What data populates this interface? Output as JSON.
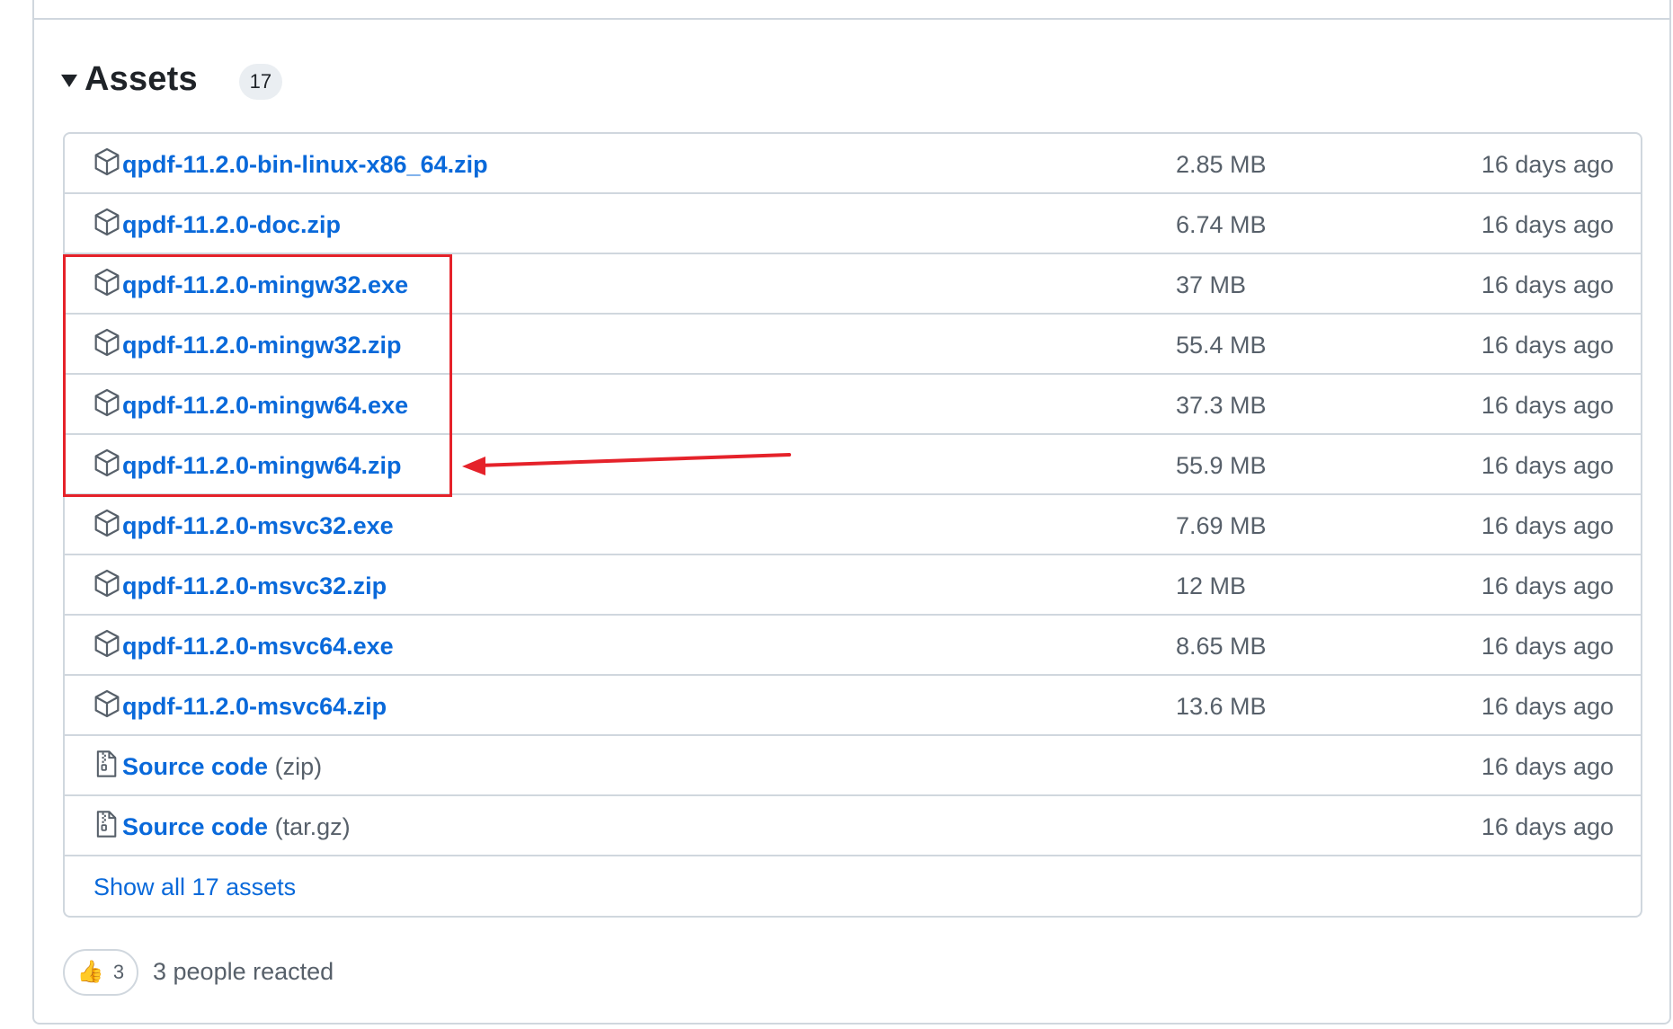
{
  "assets": {
    "title": "Assets",
    "count": "17",
    "rows": [
      {
        "name": "qpdf-11.2.0-bin-linux-x86_64.zip",
        "suffix": "",
        "size": "2.85 MB",
        "date": "16 days ago",
        "icon": "package-icon"
      },
      {
        "name": "qpdf-11.2.0-doc.zip",
        "suffix": "",
        "size": "6.74 MB",
        "date": "16 days ago",
        "icon": "package-icon"
      },
      {
        "name": "qpdf-11.2.0-mingw32.exe",
        "suffix": "",
        "size": "37 MB",
        "date": "16 days ago",
        "icon": "package-icon"
      },
      {
        "name": "qpdf-11.2.0-mingw32.zip",
        "suffix": "",
        "size": "55.4 MB",
        "date": "16 days ago",
        "icon": "package-icon"
      },
      {
        "name": "qpdf-11.2.0-mingw64.exe",
        "suffix": "",
        "size": "37.3 MB",
        "date": "16 days ago",
        "icon": "package-icon"
      },
      {
        "name": "qpdf-11.2.0-mingw64.zip",
        "suffix": "",
        "size": "55.9 MB",
        "date": "16 days ago",
        "icon": "package-icon"
      },
      {
        "name": "qpdf-11.2.0-msvc32.exe",
        "suffix": "",
        "size": "7.69 MB",
        "date": "16 days ago",
        "icon": "package-icon"
      },
      {
        "name": "qpdf-11.2.0-msvc32.zip",
        "suffix": "",
        "size": "12 MB",
        "date": "16 days ago",
        "icon": "package-icon"
      },
      {
        "name": "qpdf-11.2.0-msvc64.exe",
        "suffix": "",
        "size": "8.65 MB",
        "date": "16 days ago",
        "icon": "package-icon"
      },
      {
        "name": "qpdf-11.2.0-msvc64.zip",
        "suffix": "",
        "size": "13.6 MB",
        "date": "16 days ago",
        "icon": "package-icon"
      },
      {
        "name": "Source code",
        "suffix": "(zip)",
        "size": "",
        "date": "16 days ago",
        "icon": "file-zip-icon"
      },
      {
        "name": "Source code",
        "suffix": "(tar.gz)",
        "size": "",
        "date": "16 days ago",
        "icon": "file-zip-icon"
      }
    ],
    "show_all_label": "Show all 17 assets"
  },
  "reactions": {
    "emoji": "👍",
    "count": "3",
    "summary": "3 people reacted"
  },
  "colors": {
    "link": "#0969da",
    "annotation": "#e5222a",
    "border": "#d0d7de"
  }
}
